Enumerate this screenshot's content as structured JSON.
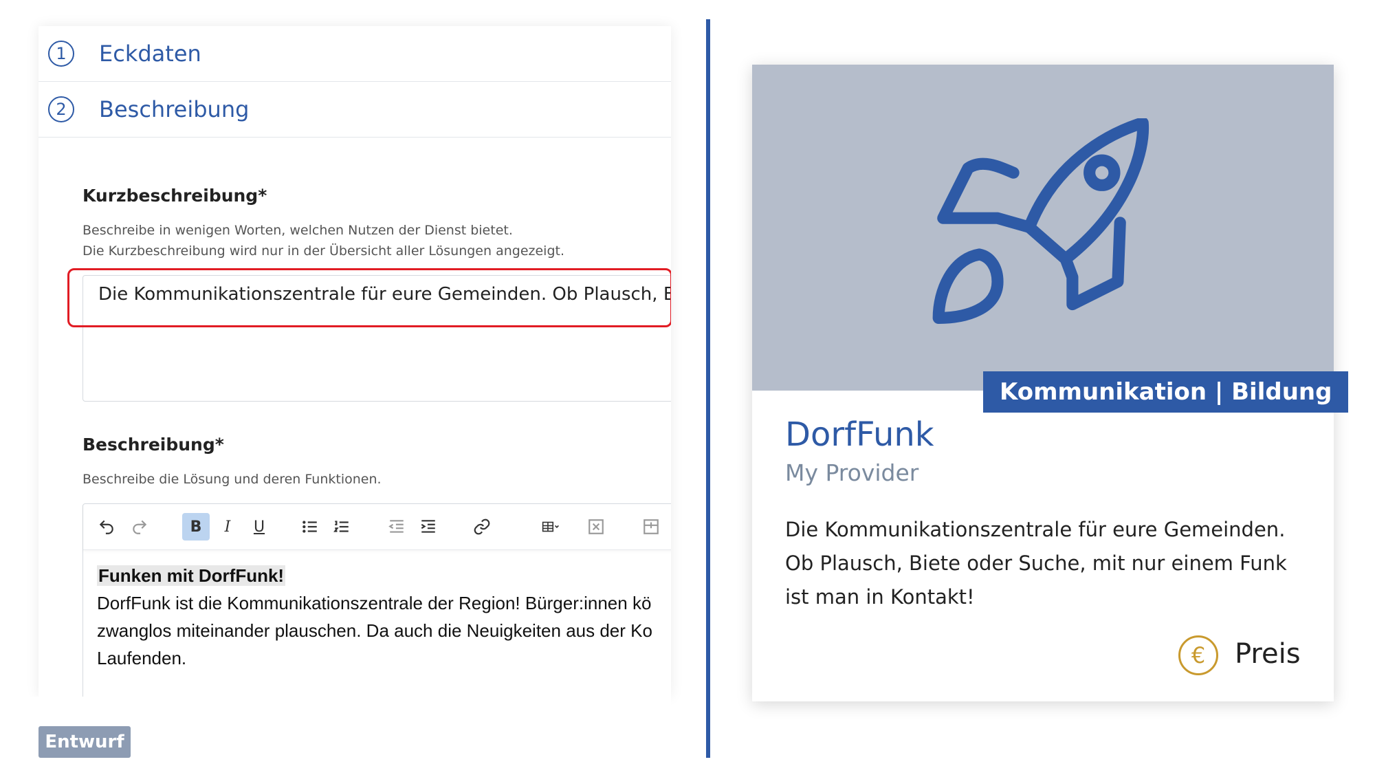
{
  "steps": [
    {
      "number": "1",
      "label": "Eckdaten"
    },
    {
      "number": "2",
      "label": "Beschreibung"
    }
  ],
  "short_description": {
    "label": "Kurzbeschreibung*",
    "help_line1": "Beschreibe in wenigen Worten, welchen Nutzen der Dienst bietet.",
    "help_line2": "Die Kurzbeschreibung wird nur in der Übersicht aller Lösungen angezeigt.",
    "value": "Die Kommunikationszentrale für eure Gemeinden. Ob Plausch, Biete od"
  },
  "description": {
    "label": "Beschreibung*",
    "help": "Beschreibe die Lösung und deren Funktionen.",
    "content_title": "Funken mit DorfFunk!",
    "content_line1": "DorfFunk ist die Kommunikationszentrale der Region! Bürger:innen kö",
    "content_line2": "zwanglos miteinander plauschen. Da auch die Neuigkeiten aus der Ko",
    "content_line3": "Laufenden."
  },
  "toolbar": {
    "icons": [
      "undo-icon",
      "redo-icon",
      "bold-icon",
      "italic-icon",
      "underline-icon",
      "bullet-list-icon",
      "numbered-list-icon",
      "outdent-icon",
      "indent-icon",
      "link-icon",
      "table-icon",
      "clear-format-icon",
      "insert-row-icon"
    ],
    "bold_label": "B",
    "italic_label": "I",
    "underline_label": "U"
  },
  "status": {
    "draft_label": "Entwurf"
  },
  "preview": {
    "category": "Kommunikation | Bildung",
    "title": "DorfFunk",
    "provider": "My Provider",
    "description": "Die Kommunikationszentrale für eure Gemeinden. Ob Plausch, Biete oder Suche, mit nur einem Funk ist man in Kontakt!",
    "price_symbol": "€",
    "price_label": "Preis",
    "image_icon": "rocket-icon"
  },
  "colors": {
    "accent": "#2e5aa6",
    "highlight_border": "#e11c24",
    "image_background": "#b5bdcb",
    "price_gold": "#c99a2e",
    "draft_badge": "#8d9cb3"
  }
}
